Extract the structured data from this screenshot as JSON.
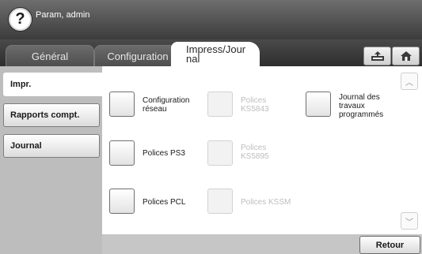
{
  "header": {
    "help_symbol": "?",
    "user_label": "Param, admin"
  },
  "tabs": [
    {
      "label": "Général",
      "active": false
    },
    {
      "label": "Configuration",
      "active": false
    },
    {
      "label": "Impress/Journal",
      "active": true
    }
  ],
  "tab_active": {
    "line1": "Impress/Jour",
    "line2": "nal"
  },
  "toolbar": {
    "icons": [
      "tray-icon",
      "home-icon"
    ]
  },
  "sidebar": {
    "items": [
      {
        "label": "Impr.",
        "selected": true
      },
      {
        "label": "Rapports compt.",
        "selected": false
      },
      {
        "label": "Journal",
        "selected": false
      }
    ]
  },
  "options": {
    "col1": [
      {
        "label_1": "Configuration",
        "label_2": "réseau",
        "enabled": true
      },
      {
        "label": "Polices PS3",
        "enabled": true
      },
      {
        "label": "Polices PCL",
        "enabled": true
      }
    ],
    "col2": [
      {
        "label_1": "Polices",
        "label_2": "KS5843",
        "enabled": false
      },
      {
        "label_1": "Polices",
        "label_2": "KS5895",
        "enabled": false
      },
      {
        "label": "Polices KSSM",
        "enabled": false
      }
    ],
    "col3": [
      {
        "label_1": "Journal des",
        "label_2": "travaux",
        "label_3": "programmés",
        "enabled": true
      }
    ]
  },
  "scroll": {
    "up": "︿",
    "down": "﹀"
  },
  "footer": {
    "back_label": "Retour"
  }
}
